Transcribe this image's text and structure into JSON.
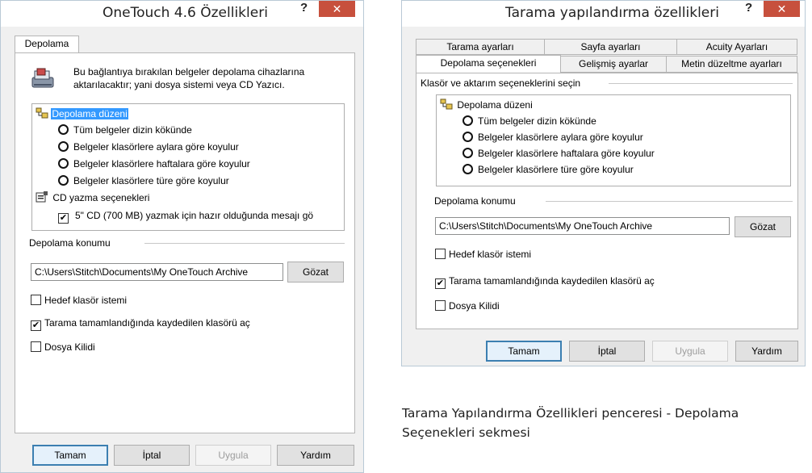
{
  "left": {
    "title": "OneTouch 4.6 Özellikleri",
    "help": "?",
    "close": "✕",
    "tab": "Depolama",
    "intro": "Bu bağlantıya bırakılan belgeler depolama cihazlarına aktarılacaktır; yani dosya sistemi veya CD Yazıcı.",
    "tree": {
      "group1": "Depolama düzeni",
      "options": [
        "Tüm belgeler dizin kökünde",
        "Belgeler klasörlere aylara göre koyulur",
        "Belgeler klasörlere haftalara göre koyulur",
        "Belgeler klasörlere türe göre koyulur"
      ],
      "group2": "CD yazma seçenekleri",
      "cd_option": "5\" CD (700 MB) yazmak için hazır olduğunda mesajı gö"
    },
    "location_label": "Depolama konumu",
    "path": "C:\\Users\\Stitch\\Documents\\My OneTouch Archive",
    "browse": "Gözat",
    "checks": {
      "target": "Hedef klasör istemi",
      "open": "Tarama tamamlandığında kaydedilen klasörü aç",
      "lock": "Dosya Kilidi"
    },
    "buttons": {
      "ok": "Tamam",
      "cancel": "İptal",
      "apply": "Uygula",
      "help": "Yardım"
    }
  },
  "right": {
    "title": "Tarama yapılandırma özellikleri",
    "help": "?",
    "close": "✕",
    "tabs_row1": [
      "Tarama ayarları",
      "Sayfa ayarları",
      "Acuity Ayarları"
    ],
    "tabs_row2": [
      "Depolama seçenekleri",
      "Gelişmiş ayarlar",
      "Metin düzeltme ayarları"
    ],
    "group_label": "Klasör ve aktarım seçeneklerini seçin",
    "tree": {
      "group1": "Depolama düzeni",
      "options": [
        "Tüm belgeler dizin kökünde",
        "Belgeler klasörlere aylara göre koyulur",
        "Belgeler klasörlere haftalara göre koyulur",
        "Belgeler klasörlere türe göre koyulur"
      ]
    },
    "location_label": "Depolama konumu",
    "path": "C:\\Users\\Stitch\\Documents\\My OneTouch Archive",
    "browse": "Gözat",
    "checks": {
      "target": "Hedef klasör istemi",
      "open": "Tarama tamamlandığında kaydedilen klasörü aç",
      "lock": "Dosya Kilidi"
    },
    "buttons": {
      "ok": "Tamam",
      "cancel": "İptal",
      "apply": "Uygula",
      "help": "Yardım"
    }
  },
  "caption": {
    "line1": "Tarama Yapılandırma Özellikleri penceresi - Depolama",
    "line2": "Seçenekleri sekmesi"
  }
}
